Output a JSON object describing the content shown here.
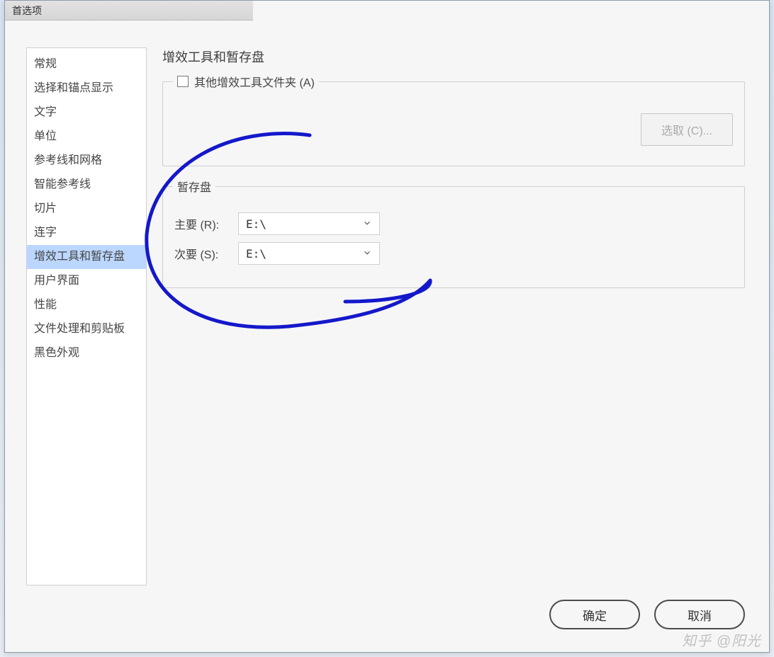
{
  "window": {
    "title": "首选项"
  },
  "sidebar": {
    "items": [
      {
        "label": "常规"
      },
      {
        "label": "选择和锚点显示"
      },
      {
        "label": "文字"
      },
      {
        "label": "单位"
      },
      {
        "label": "参考线和网格"
      },
      {
        "label": "智能参考线"
      },
      {
        "label": "切片"
      },
      {
        "label": "连字"
      },
      {
        "label": "增效工具和暂存盘",
        "selected": true
      },
      {
        "label": "用户界面"
      },
      {
        "label": "性能"
      },
      {
        "label": "文件处理和剪贴板"
      },
      {
        "label": "黑色外观"
      }
    ]
  },
  "main": {
    "heading": "增效工具和暂存盘",
    "plugins_group": {
      "checkbox_label": "其他增效工具文件夹 (A)",
      "choose_button": "选取 (C)..."
    },
    "scratch_group": {
      "legend": "暂存盘",
      "primary_label": "主要 (R):",
      "primary_value": "E:\\",
      "secondary_label": "次要 (S):",
      "secondary_value": "E:\\"
    }
  },
  "buttons": {
    "ok": "确定",
    "cancel": "取消"
  },
  "watermark": "知乎 @阳光"
}
